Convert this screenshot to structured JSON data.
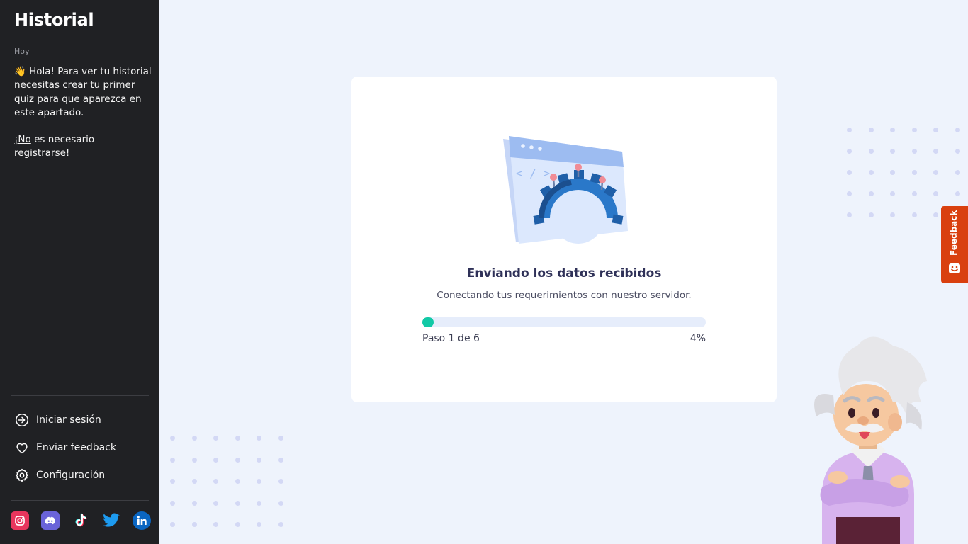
{
  "sidebar": {
    "title": "Historial",
    "date_label": "Hoy",
    "message_line1": "👋 Hola! Para ver tu historial necesitas crear tu primer quiz para que aparezca en este apartado.",
    "message_no": "¡No",
    "message_line2_rest": " es necesario registrarse!",
    "menu": [
      {
        "label": "Iniciar sesión",
        "icon": "login-icon"
      },
      {
        "label": "Enviar feedback",
        "icon": "heart-icon"
      },
      {
        "label": "Configuración",
        "icon": "gear-icon"
      }
    ],
    "socials": [
      "instagram-icon",
      "discord-icon",
      "tiktok-icon",
      "twitter-icon",
      "linkedin-icon"
    ]
  },
  "card": {
    "title": "Enviando los datos recibidos",
    "subtitle": "Conectando tus requerimientos con nuestro servidor.",
    "step_label": "Paso 1 de 6",
    "percent_label": "4%",
    "progress": 0.04
  },
  "feedback_tab": {
    "label": "Feedback"
  },
  "colors": {
    "sidebar_bg": "#202124",
    "page_bg": "#eef3fc",
    "accent": "#12c9a6",
    "feedback": "#d9400f"
  }
}
